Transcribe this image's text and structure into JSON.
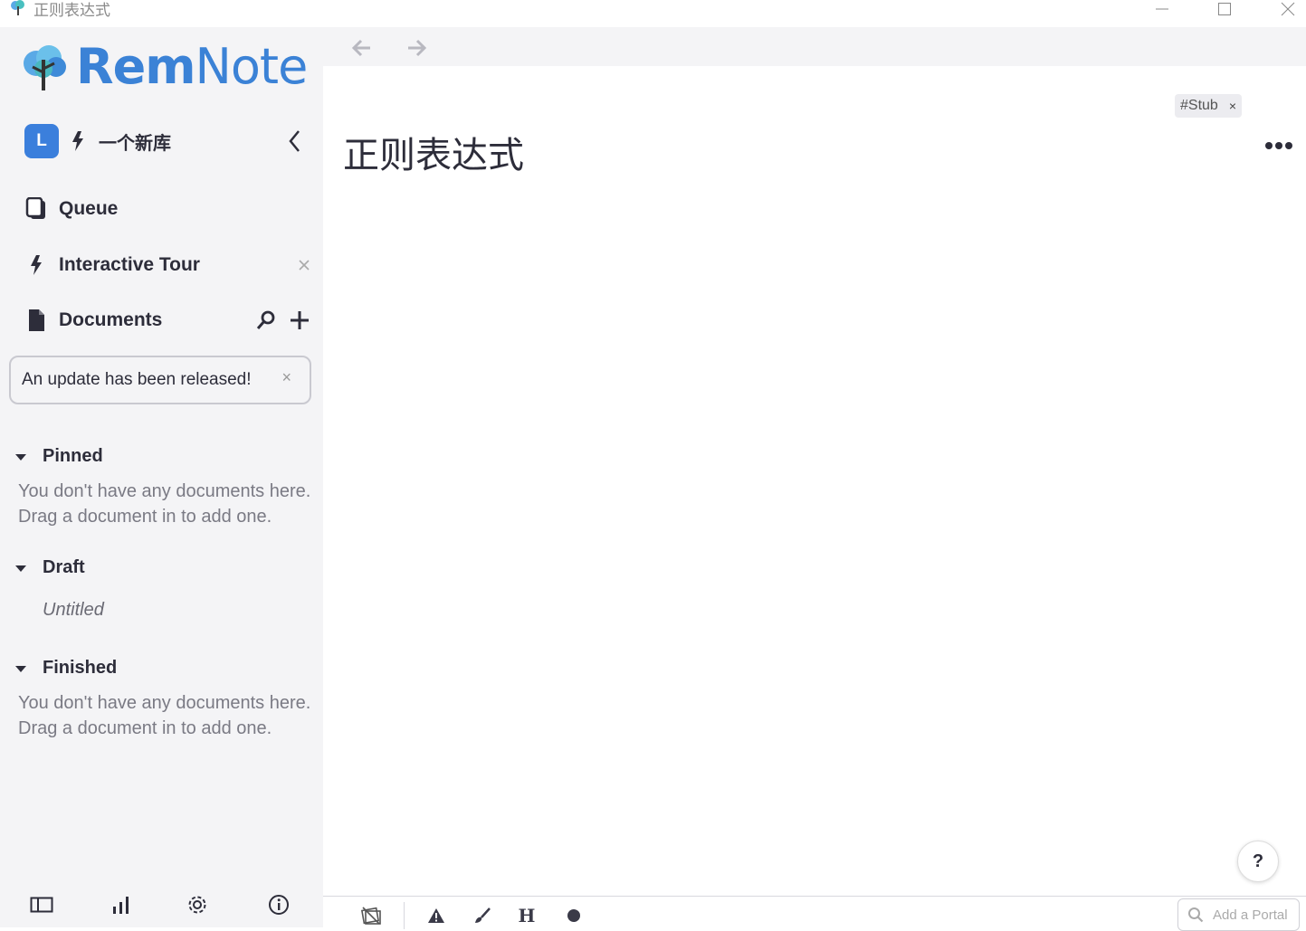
{
  "window": {
    "title": "正则表达式"
  },
  "sidebar": {
    "logo": {
      "rem": "Rem",
      "note": "Note"
    },
    "knowledge_base": {
      "avatar_letter": "L",
      "name": "一个新库"
    },
    "nav": [
      {
        "label": "Queue",
        "icon": "queue-icon"
      },
      {
        "label": "Interactive Tour",
        "icon": "bolt-icon"
      },
      {
        "label": "Documents",
        "icon": "document-icon"
      }
    ],
    "update_banner": {
      "text": "An update has been released!",
      "close": "×"
    },
    "sections": {
      "pinned": {
        "label": "Pinned",
        "empty_line1": "You don't have any documents here.",
        "empty_line2": "Drag a document in to add one."
      },
      "draft": {
        "label": "Draft",
        "items": [
          "Untitled"
        ]
      },
      "finished": {
        "label": "Finished",
        "empty_line1": "You don't have any documents here.",
        "empty_line2": "Drag a document in to add one."
      }
    },
    "bottom_icons": [
      "sidebar-toggle-icon",
      "stats-icon",
      "settings-icon",
      "info-icon"
    ]
  },
  "main": {
    "tag": {
      "label": "#Stub",
      "remove": "×"
    },
    "title": "正则表达式",
    "help_label": "?"
  },
  "toolbar": {
    "icons": [
      "flashcard-icon",
      "warning-icon",
      "brush-icon",
      "heading-icon",
      "circle-icon"
    ],
    "heading_glyph": "H",
    "portal_placeholder": "Add a Portal"
  },
  "colors": {
    "accent": "#3b82d6",
    "sidebar_bg": "#f4f4f6",
    "text": "#2d2d3a",
    "muted": "#7a7a84"
  }
}
